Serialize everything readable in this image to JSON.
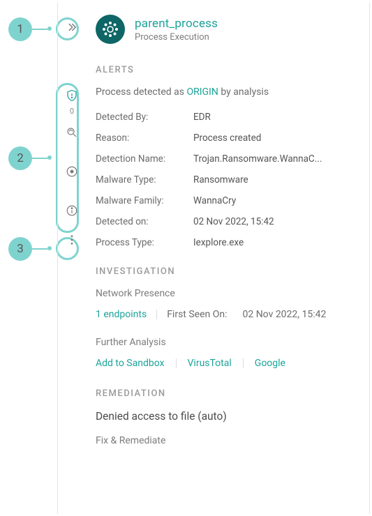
{
  "callouts": {
    "one": "1",
    "two": "2",
    "three": "3"
  },
  "header": {
    "title": "parent_process",
    "subtitle": "Process Execution"
  },
  "alerts": {
    "section_title": "ALERTS",
    "summary_prefix": "Process detected as ",
    "summary_origin": "ORIGIN",
    "summary_suffix": " by analysis",
    "rows": [
      {
        "key": "Detected By:",
        "val": "EDR"
      },
      {
        "key": "Reason:",
        "val": "Process created"
      },
      {
        "key": "Detection Name:",
        "val": "Trojan.Ransomware.WannaC..."
      },
      {
        "key": "Malware Type:",
        "val": "Ransomware"
      },
      {
        "key": "Malware Family:",
        "val": "WannaCry"
      },
      {
        "key": "Detected on:",
        "val": "02 Nov 2022, 15:42"
      },
      {
        "key": "Process Type:",
        "val": "Iexplore.exe"
      }
    ],
    "shield_count": "0"
  },
  "investigation": {
    "section_title": "INVESTIGATION",
    "network_presence": "Network Presence",
    "endpoints_link": "1 endpoints",
    "first_seen_label": "First Seen On:",
    "first_seen_value": "02 Nov 2022, 15:42",
    "further_analysis": "Further Analysis",
    "links": {
      "sandbox": "Add to Sandbox",
      "virustotal": "VirusTotal",
      "google": "Google"
    }
  },
  "remediation": {
    "section_title": "REMEDIATION",
    "message": "Denied access to file (auto)",
    "fix_label": "Fix & Remediate"
  }
}
